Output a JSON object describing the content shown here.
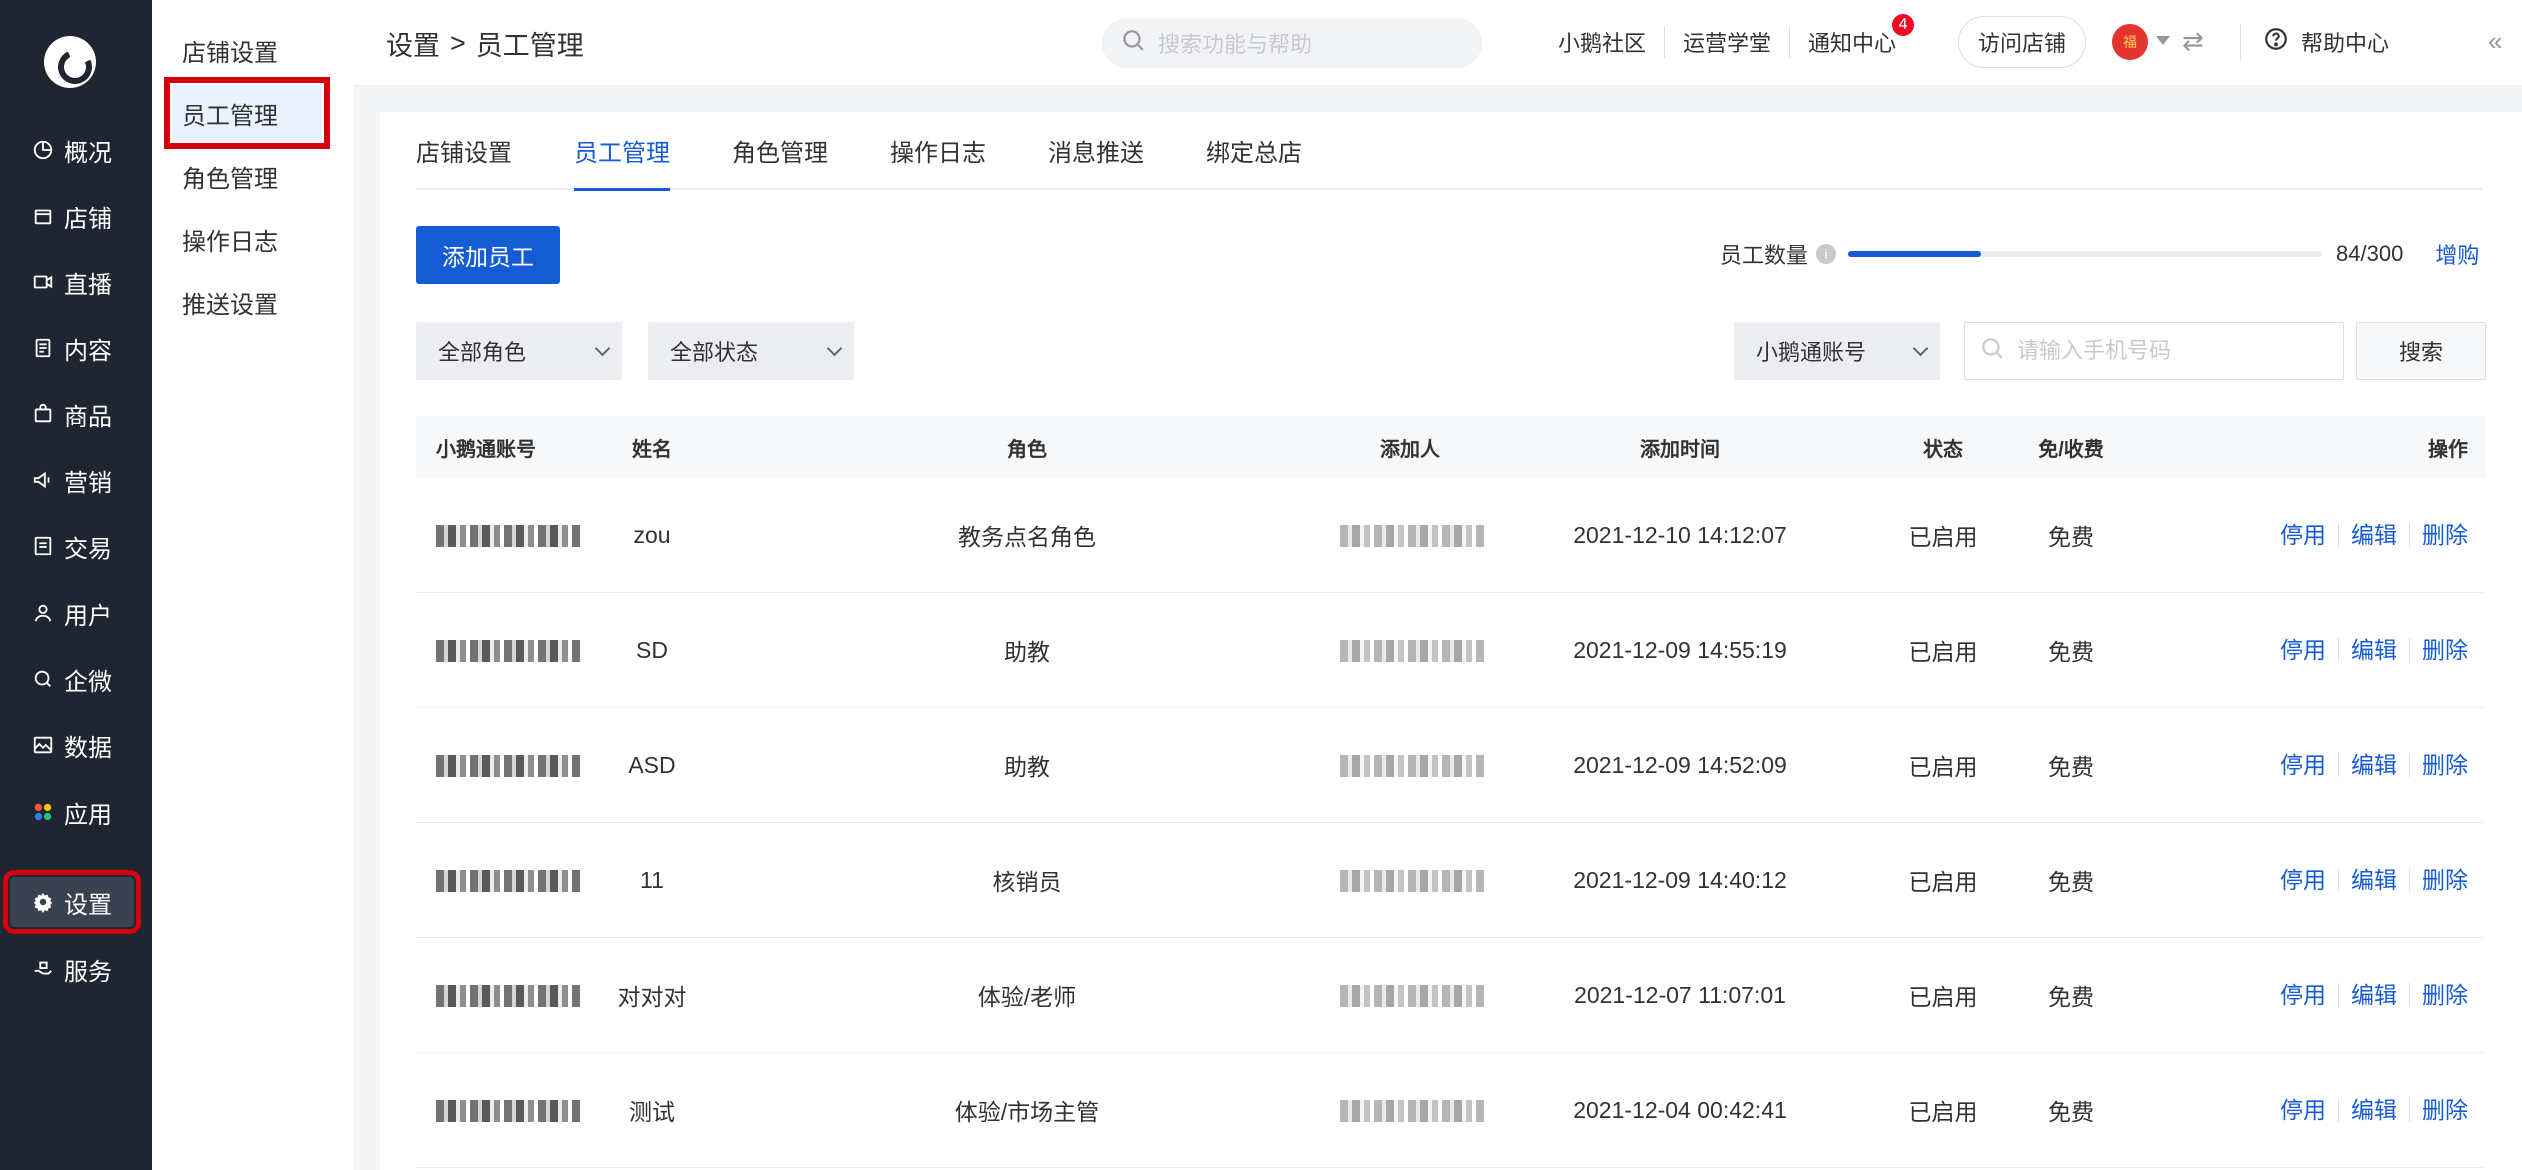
{
  "nav": {
    "items": [
      {
        "label": "概况",
        "icon": "pie-chart-icon"
      },
      {
        "label": "店铺",
        "icon": "store-icon"
      },
      {
        "label": "直播",
        "icon": "live-camera-icon"
      },
      {
        "label": "内容",
        "icon": "document-icon"
      },
      {
        "label": "商品",
        "icon": "shopping-bag-icon"
      },
      {
        "label": "营销",
        "icon": "megaphone-icon"
      },
      {
        "label": "交易",
        "icon": "receipt-icon"
      },
      {
        "label": "用户",
        "icon": "user-icon"
      },
      {
        "label": "企微",
        "icon": "chat-icon"
      },
      {
        "label": "数据",
        "icon": "image-chart-icon"
      },
      {
        "label": "应用",
        "icon": "apps-grid-icon"
      },
      {
        "label": "设置",
        "icon": "gear-icon"
      },
      {
        "label": "服务",
        "icon": "service-hand-icon"
      }
    ]
  },
  "subnav": {
    "items": [
      {
        "label": "店铺设置"
      },
      {
        "label": "员工管理"
      },
      {
        "label": "角色管理"
      },
      {
        "label": "操作日志"
      },
      {
        "label": "推送设置"
      }
    ]
  },
  "topbar": {
    "breadcrumb_root": "设置",
    "breadcrumb_sep": ">",
    "breadcrumb_current": "员工管理",
    "search_placeholder": "搜索功能与帮助",
    "links": [
      "小鹅社区",
      "运营学堂",
      "通知中心"
    ],
    "notification_count": "4",
    "visit_store": "访问店铺",
    "avatar_text": "福",
    "help": "帮助中心"
  },
  "tabs": [
    "店铺设置",
    "员工管理",
    "角色管理",
    "操作日志",
    "消息推送",
    "绑定总店"
  ],
  "toolbar": {
    "add_label": "添加员工",
    "count_label": "员工数量",
    "count_value": "84/300",
    "count_fraction": 0.28,
    "expand_label": "增购",
    "role_filter": "全部角色",
    "status_filter": "全部状态",
    "account_type": "小鹅通账号",
    "phone_placeholder": "请输入手机号码",
    "search_label": "搜索"
  },
  "colors": {
    "accent": "#155bd4",
    "nav_bg": "#1f2531",
    "highlight": "#d7000f"
  },
  "table": {
    "headers": [
      "小鹅通账号",
      "姓名",
      "角色",
      "添加人",
      "添加时间",
      "状态",
      "免/收费",
      "操作"
    ],
    "actions": [
      "停用",
      "编辑",
      "删除"
    ],
    "rows": [
      {
        "name": "zou",
        "role": "教务点名角色",
        "time": "2021-12-10 14:12:07",
        "status": "已启用",
        "fee": "免费"
      },
      {
        "name": "SD",
        "role": "助教",
        "time": "2021-12-09 14:55:19",
        "status": "已启用",
        "fee": "免费"
      },
      {
        "name": "ASD",
        "role": "助教",
        "time": "2021-12-09 14:52:09",
        "status": "已启用",
        "fee": "免费"
      },
      {
        "name": "11",
        "role": "核销员",
        "time": "2021-12-09 14:40:12",
        "status": "已启用",
        "fee": "免费"
      },
      {
        "name": "对对对",
        "role": "体验/老师",
        "time": "2021-12-07 11:07:01",
        "status": "已启用",
        "fee": "免费"
      },
      {
        "name": "测试",
        "role": "体验/市场主管",
        "time": "2021-12-04 00:42:41",
        "status": "已启用",
        "fee": "免费"
      }
    ]
  }
}
